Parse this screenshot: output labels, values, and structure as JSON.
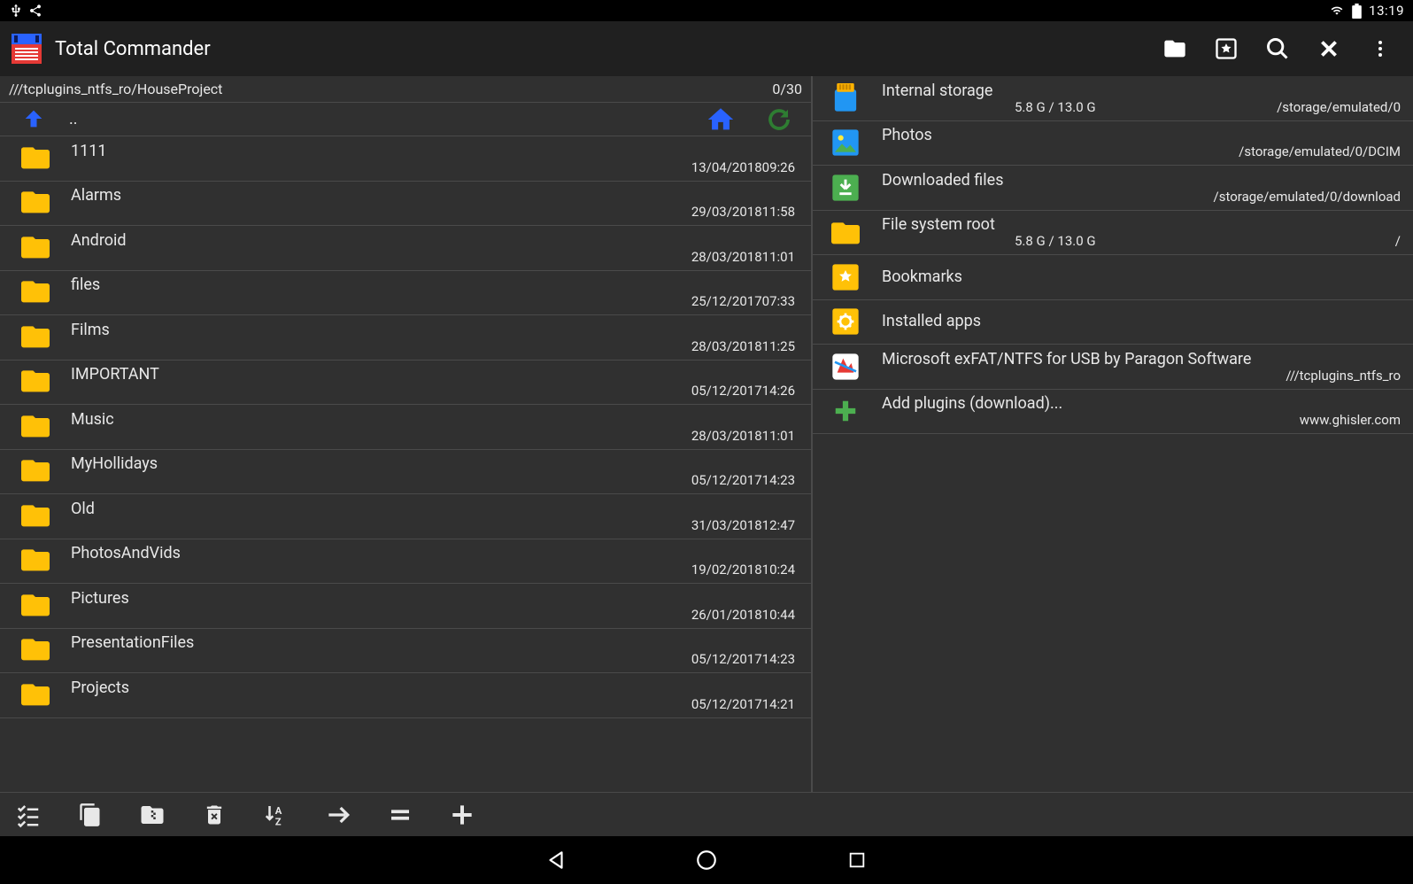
{
  "status": {
    "time": "13:19"
  },
  "app": {
    "title": "Total Commander"
  },
  "leftPanel": {
    "path": "///tcplugins_ntfs_ro/HouseProject",
    "count": "0/30",
    "up": "..",
    "items": [
      {
        "name": "1111",
        "type": "<dir>",
        "date": "13/04/2018",
        "time": "09:26"
      },
      {
        "name": "Alarms",
        "type": "<dir>",
        "date": "29/03/2018",
        "time": "11:58"
      },
      {
        "name": "Android",
        "type": "<dir>",
        "date": "28/03/2018",
        "time": "11:01"
      },
      {
        "name": "files",
        "type": "<dir>",
        "date": "25/12/2017",
        "time": "07:33"
      },
      {
        "name": "Films",
        "type": "<dir>",
        "date": "28/03/2018",
        "time": "11:25"
      },
      {
        "name": "IMPORTANT",
        "type": "<dir>",
        "date": "05/12/2017",
        "time": "14:26"
      },
      {
        "name": "Music",
        "type": "<dir>",
        "date": "28/03/2018",
        "time": "11:01"
      },
      {
        "name": "MyHollidays",
        "type": "<dir>",
        "date": "05/12/2017",
        "time": "14:23"
      },
      {
        "name": "Old",
        "type": "<dir>",
        "date": "31/03/2018",
        "time": "12:47"
      },
      {
        "name": "PhotosAndVids",
        "type": "<dir>",
        "date": "19/02/2018",
        "time": "10:24"
      },
      {
        "name": "Pictures",
        "type": "<dir>",
        "date": "26/01/2018",
        "time": "10:44"
      },
      {
        "name": "PresentationFiles",
        "type": "<dir>",
        "date": "05/12/2017",
        "time": "14:23"
      },
      {
        "name": "Projects",
        "type": "<dir>",
        "date": "05/12/2017",
        "time": "14:21"
      }
    ]
  },
  "rightPanel": {
    "items": [
      {
        "name": "Internal storage",
        "sub": "5.8 G / 13.0 G",
        "path": "/storage/emulated/0",
        "icon": "sdcard"
      },
      {
        "name": "Photos",
        "sub": "",
        "path": "/storage/emulated/0/DCIM",
        "icon": "photos"
      },
      {
        "name": "Downloaded files",
        "sub": "",
        "path": "/storage/emulated/0/download",
        "icon": "download"
      },
      {
        "name": "File system root",
        "sub": "5.8 G / 13.0 G",
        "path": "/",
        "icon": "folder"
      },
      {
        "name": "Bookmarks",
        "sub": "",
        "path": "",
        "icon": "bookmark"
      },
      {
        "name": "Installed apps",
        "sub": "",
        "path": "",
        "icon": "apps"
      },
      {
        "name": "Microsoft exFAT/NTFS for USB by Paragon Software",
        "sub": "",
        "path": "///tcplugins_ntfs_ro",
        "icon": "plugin"
      },
      {
        "name": "Add plugins (download)...",
        "sub": "",
        "path": "www.ghisler.com",
        "icon": "plus"
      }
    ]
  }
}
